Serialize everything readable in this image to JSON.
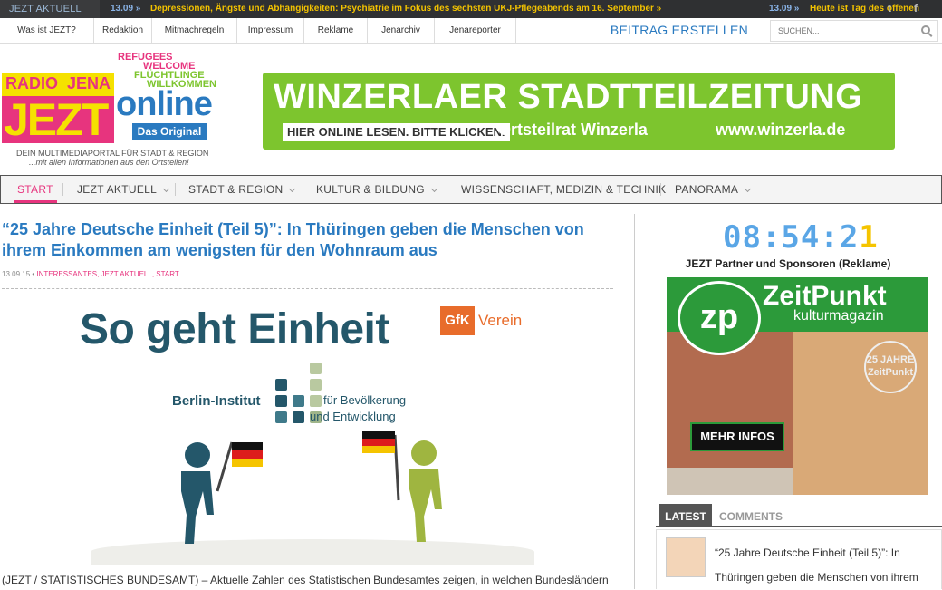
{
  "ticker": {
    "label": "JEZT AKTUELL",
    "items": [
      {
        "date": "13.09 »",
        "text": "Depressionen, Ängste und Abhängigkeiten: Psychiatrie im Fokus des sechsten UKJ-Pflegeabends am 16. September »"
      },
      {
        "date": "13.09 »",
        "text": "Heute ist Tag des offenen"
      }
    ],
    "icon_twitter": "twitter-icon",
    "icon_facebook": "facebook-icon",
    "twitter_glyph": "t",
    "facebook_glyph": "f"
  },
  "topnav": {
    "items": [
      "Was ist JEZT?",
      "Redaktion",
      "Mitmachregeln",
      "Impressum",
      "Reklame",
      "Jenarchiv",
      "Jenareporter"
    ],
    "create_post": "BEITRAG ERSTELLEN",
    "search_placeholder": "SUCHEN..."
  },
  "logo": {
    "radio": "RADIO",
    "jena": "JENA",
    "jezt": "JEZT",
    "online": "online",
    "original": "Das Original",
    "refugees": [
      "REFUGEES",
      "WELCOME",
      "FLÜCHTLINGE",
      "WILLKOMMEN"
    ],
    "tagline1": "DEIN MULTIMEDIAPORTAL FÜR STADT & REGION",
    "tagline2": "...mit allen Informationen aus den Ortsteilen!"
  },
  "banner": {
    "title": "WINZERLAER STADTTEILZEITUNG",
    "cta": "HIER ONLINE LESEN. BITTE KLICKEN.",
    "subtitle": "Ortsteilrat Winzerla",
    "url": "www.winzerla.de"
  },
  "mainnav": {
    "items": [
      {
        "label": "START",
        "dropdown": false
      },
      {
        "label": "JEZT AKTUELL",
        "dropdown": true
      },
      {
        "label": "STADT & REGION",
        "dropdown": true
      },
      {
        "label": "KULTUR & BILDUNG",
        "dropdown": true
      },
      {
        "label": "WISSENSCHAFT, MEDIZIN & TECHNIK",
        "dropdown": false
      },
      {
        "label": "PANORAMA",
        "dropdown": true
      }
    ],
    "active": "START"
  },
  "article": {
    "title": "“25 Jahre Deutsche Einheit (Teil 5)”: In Thüringen geben die Menschen von ihrem Einkommen am wenigsten für den Wohnraum aus",
    "date": "13.09.15",
    "categories": "INTERESSANTES, JEZT AKTUELL, START",
    "image": {
      "headline": "So geht Einheit",
      "gfk": "GfK",
      "verein": "Verein",
      "institute": "Berlin-Institut",
      "institute_sub1": "für Bevölkerung",
      "institute_sub2": "und Entwicklung"
    },
    "lead": "(JEZT / STATISTISCHES BUNDESAMT) – Aktuelle Zahlen des Statistischen Bundesamtes zeigen, in welchen Bundesländern"
  },
  "sidebar": {
    "clock": "08:54:2",
    "clock_last": "1",
    "partners_title": "JEZT Partner und Sponsoren (Reklame)",
    "ad": {
      "logo": "zp",
      "brand": "ZeitPunkt",
      "tagline": "kulturmagazin",
      "stamp": "25 JAHRE ZeitPunkt",
      "button": "MEHR INFOS"
    },
    "tabs": [
      "LATEST",
      "COMMENTS"
    ],
    "latest_text": "“25 Jahre Deutsche Einheit (Teil 5)”: In Thüringen geben die Menschen von ihrem"
  },
  "colors": {
    "accent_blue": "#2a7ac0",
    "accent_pink": "#e7347e",
    "banner_green": "#7dc52e",
    "ticker_yellow": "#f2c200"
  }
}
